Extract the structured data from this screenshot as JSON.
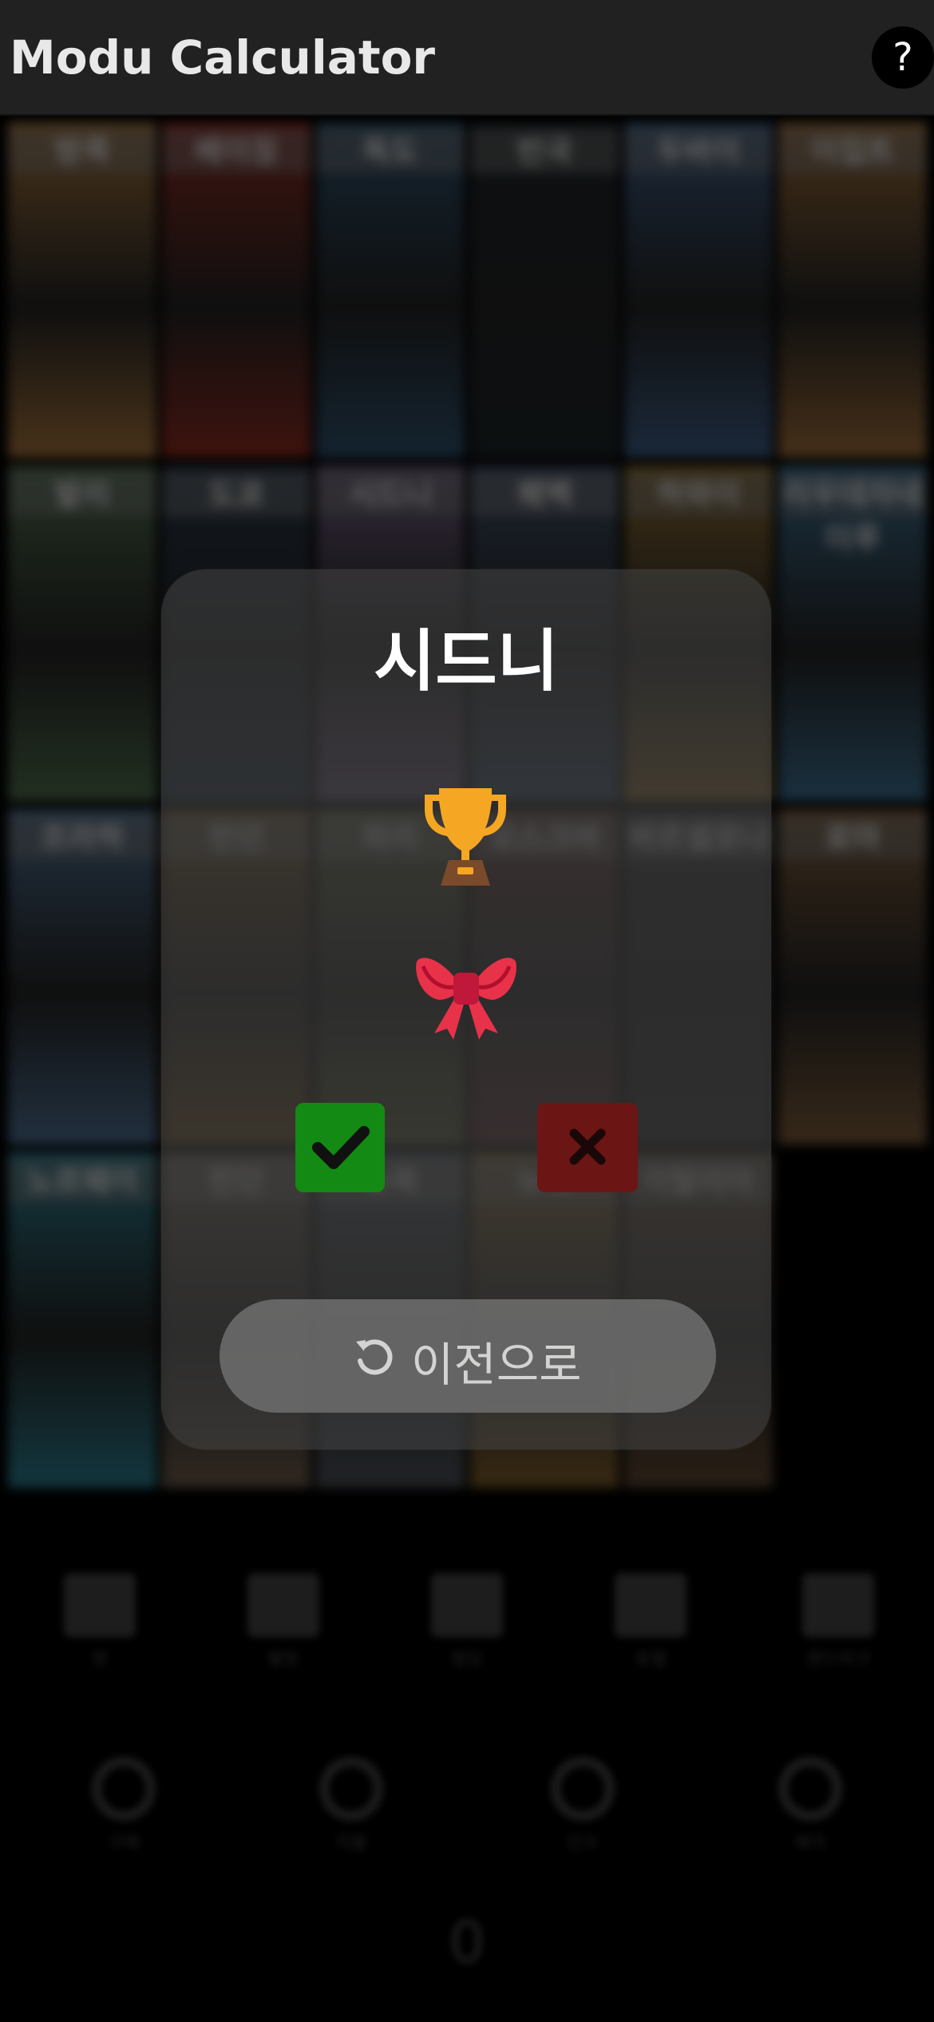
{
  "header": {
    "title": "Modu Calculator",
    "help_label": "?"
  },
  "grid": {
    "tiles": [
      {
        "name": "방콕",
        "color": "#a0703a"
      },
      {
        "name": "베이징",
        "color": "#8a2a20"
      },
      {
        "name": "독도",
        "color": "#2d4f6a"
      },
      {
        "name": "빈국",
        "color": "#1c2428"
      },
      {
        "name": "두바이",
        "color": "#3c5a80"
      },
      {
        "name": "이집트",
        "color": "#9a6a38"
      },
      {
        "name": "발리",
        "color": "#4d6a4a"
      },
      {
        "name": "도쿄",
        "color": "#283848"
      },
      {
        "name": "시드니",
        "color": "#6a5878"
      },
      {
        "name": "퀘벡",
        "color": "#3c4c64"
      },
      {
        "name": "하와이",
        "color": "#8a6a30"
      },
      {
        "name": "리우데자네이루",
        "color": "#3a6a8a"
      },
      {
        "name": "프라하",
        "color": "#4a6a8a"
      },
      {
        "name": "런던",
        "color": "#6a4a20"
      },
      {
        "name": "파리",
        "color": "#5a5a3a"
      },
      {
        "name": "모스크바",
        "color": "#5a2a2a"
      },
      {
        "name": "바르셀로나",
        "color": "#2a2a2a"
      },
      {
        "name": "로마",
        "color": "#7a5a3a"
      },
      {
        "name": "노르웨이",
        "color": "#2a7a8a"
      },
      {
        "name": "런던",
        "color": "#6a5a4a"
      },
      {
        "name": "뉴욕",
        "color": "#4a5058"
      },
      {
        "name": "뉴욕",
        "color": "#7a5a2a"
      },
      {
        "name": "이탈리아",
        "color": "#5a4430"
      }
    ]
  },
  "bottom_nav": {
    "items": [
      {
        "label": "땅",
        "icon": "flag-icon"
      },
      {
        "label": "별장",
        "icon": "shop-icon"
      },
      {
        "label": "빌딩",
        "icon": "building-icon"
      },
      {
        "label": "호텔",
        "icon": "hotel-icon"
      },
      {
        "label": "랜드마크",
        "icon": "landmark-icon"
      }
    ]
  },
  "controls": {
    "items": [
      {
        "label": "구매",
        "icon": "play-icon"
      },
      {
        "label": "지불",
        "icon": "pause-icon"
      },
      {
        "label": "인수",
        "icon": "stop-icon"
      },
      {
        "label": "매각",
        "icon": "stop-icon"
      }
    ],
    "counter": "0"
  },
  "modal": {
    "title": "시드니",
    "trophy_icon": "trophy-icon",
    "bow_icon": "bow-icon",
    "confirm_icon": "check-icon",
    "cancel_icon": "close-icon",
    "back_label": "이전으로",
    "colors": {
      "confirm": "#138a13",
      "cancel": "#6b1515",
      "trophy": "#f5a623",
      "bow": "#e8324a"
    }
  }
}
